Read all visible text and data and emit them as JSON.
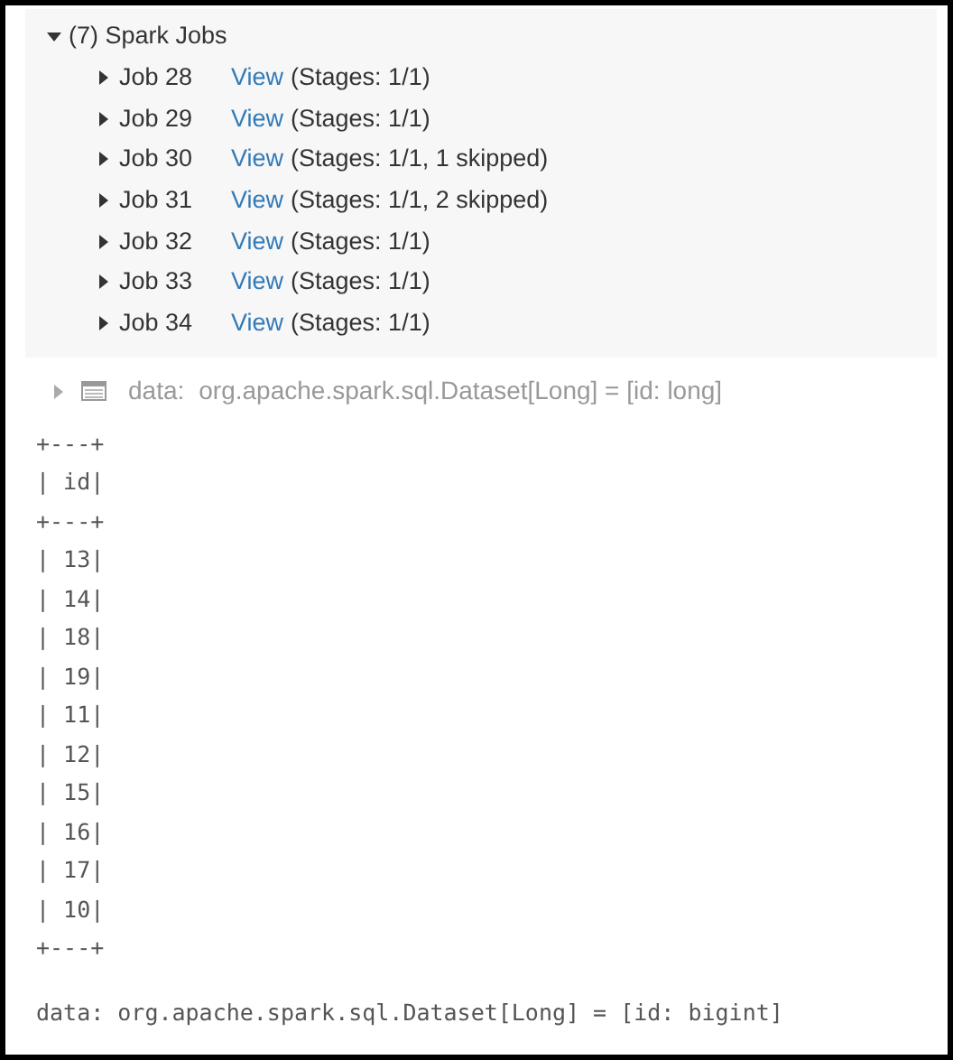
{
  "spark_jobs": {
    "title": "(7) Spark Jobs",
    "expanded": true,
    "jobs": [
      {
        "label": "Job 28",
        "link": "View",
        "stages": "(Stages: 1/1)",
        "expanded": false
      },
      {
        "label": "Job 29",
        "link": "View",
        "stages": "(Stages: 1/1)",
        "expanded": false
      },
      {
        "label": "Job 30",
        "link": "View",
        "stages": "(Stages: 1/1, 1 skipped)",
        "expanded": false
      },
      {
        "label": "Job 31",
        "link": "View",
        "stages": "(Stages: 1/1, 2 skipped)",
        "expanded": false
      },
      {
        "label": "Job 32",
        "link": "View",
        "stages": "(Stages: 1/1)",
        "expanded": false
      },
      {
        "label": "Job 33",
        "link": "View",
        "stages": "(Stages: 1/1)",
        "expanded": false
      },
      {
        "label": "Job 34",
        "link": "View",
        "stages": "(Stages: 1/1)",
        "expanded": false
      }
    ]
  },
  "schema_row": {
    "label": "data:",
    "type": "org.apache.spark.sql.Dataset[Long] = [id: long]",
    "expanded": false
  },
  "output_lines": [
    "+---+",
    "| id|",
    "+---+",
    "| 13|",
    "| 14|",
    "| 18|",
    "| 19|",
    "| 11|",
    "| 12|",
    "| 15|",
    "| 16|",
    "| 17|",
    "| 10|",
    "+---+"
  ],
  "result_line": "data: org.apache.spark.sql.Dataset[Long] = [id: bigint]"
}
